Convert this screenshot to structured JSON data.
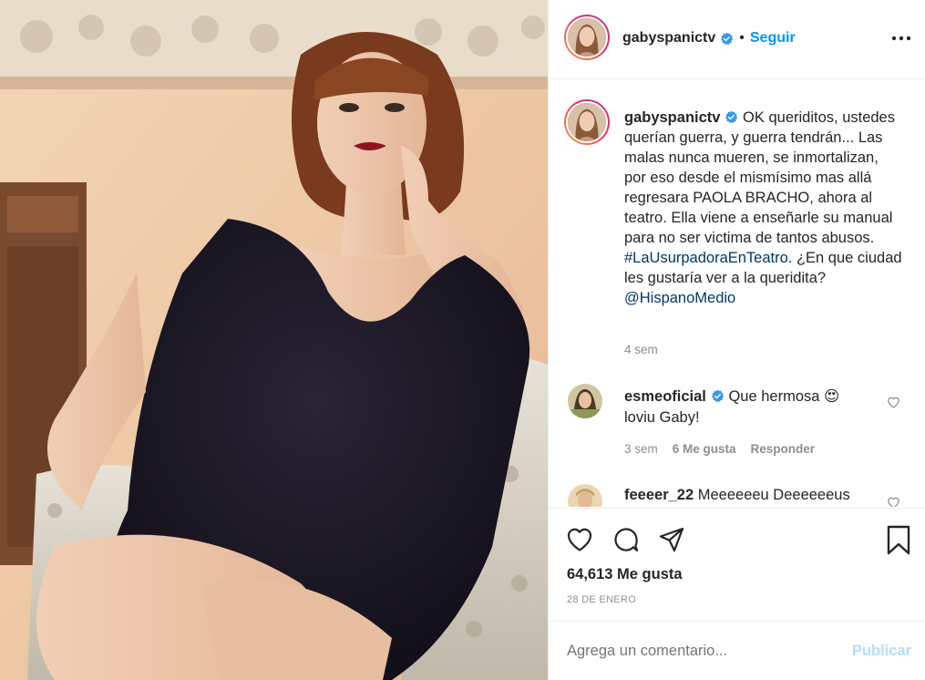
{
  "post": {
    "username": "gabyspanictv",
    "follow_label": "Seguir",
    "separator": "•",
    "more_icon": "more-horizontal-icon",
    "verified_icon": "verified-badge-icon",
    "caption_text": " OK queriditos, ustedes querían guerra, y guerra tendrán... Las malas nunca mueren, se inmortalizan, por eso desde el mismísimo mas allá regresara PAOLA BRACHO, ahora al teatro. Ella viene a enseñarle su manual para no ser victima de tantos abusos. ",
    "hashtag": "#LaUsurpadoraEnTeatro",
    "caption_text_2": ". ¿En que ciudad les gustaría ver a la queridita? ",
    "mention": "@HispanoMedio",
    "caption_time": "4 sem"
  },
  "comments": [
    {
      "username": "esmeoficial",
      "text": " Que hermosa 😍 loviu Gaby!",
      "time": "3 sem",
      "likes": "6 Me gusta",
      "reply_label": "Responder"
    },
    {
      "username": "feeeer_22",
      "text": " Meeeeeeu Deeeeeeus"
    }
  ],
  "actions": {
    "like_icon": "heart-outline-icon",
    "comment_icon": "comment-bubble-icon",
    "share_icon": "paper-plane-icon",
    "save_icon": "bookmark-icon",
    "likes_count": "64,613 Me gusta",
    "date": "28 DE ENERO"
  },
  "add_comment": {
    "placeholder": "Agrega un comentario...",
    "publish_label": "Publicar"
  },
  "colors": {
    "link": "#00376b",
    "follow": "#0095f6",
    "muted": "#8e8e8e",
    "publish_disabled": "#b2dffc"
  }
}
